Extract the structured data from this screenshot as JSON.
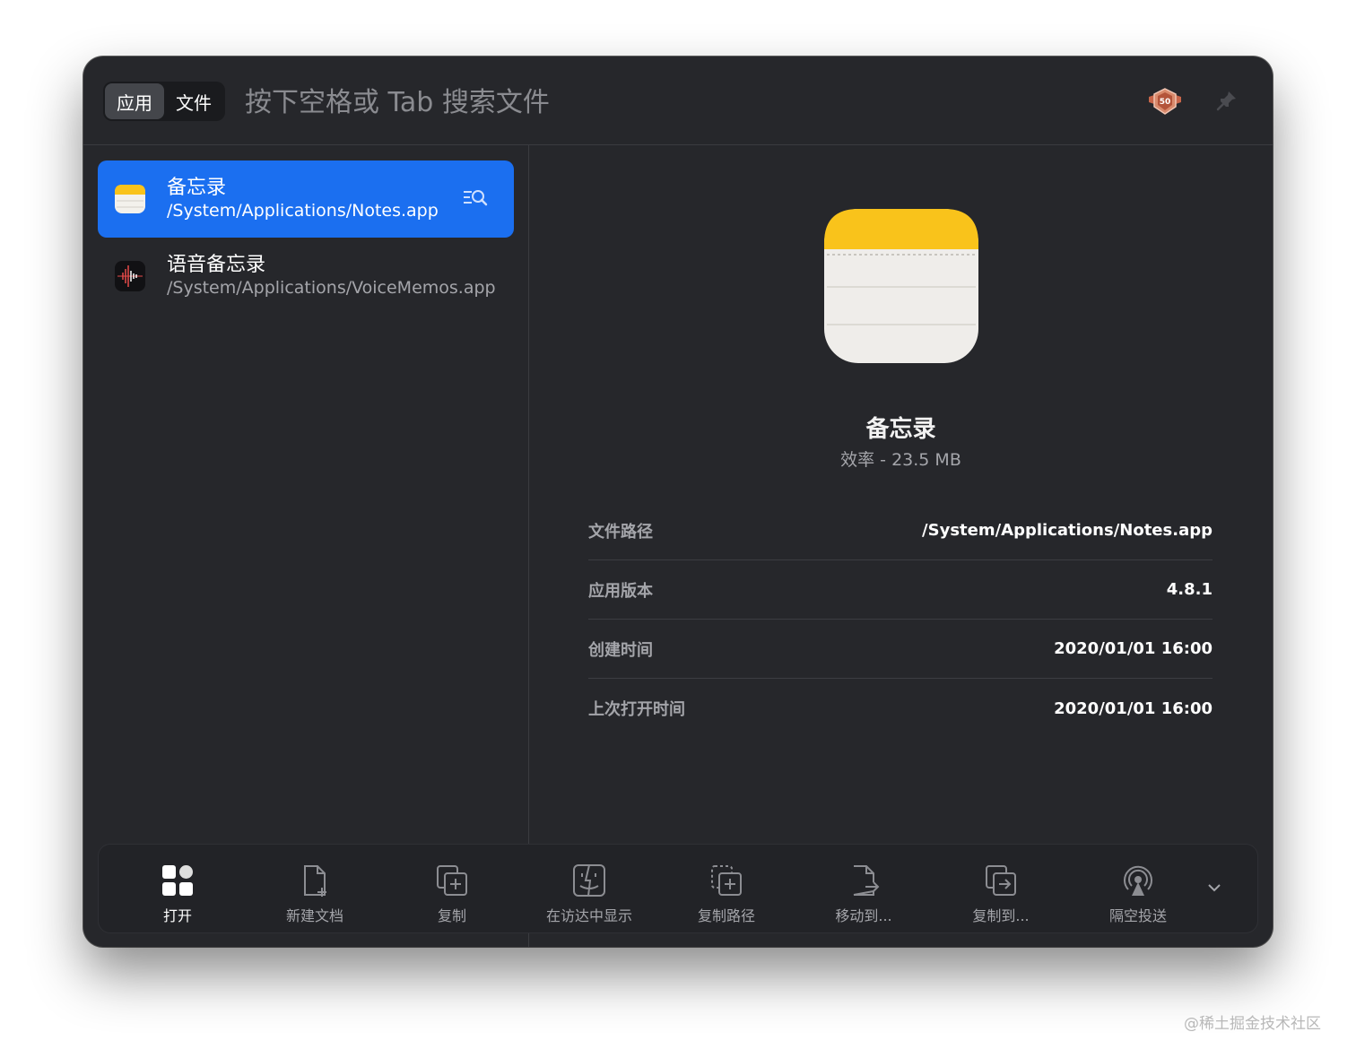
{
  "header": {
    "segments": [
      {
        "label": "应用",
        "active": true
      },
      {
        "label": "文件",
        "active": false
      }
    ],
    "search_placeholder": "按下空格或 Tab 搜索文件",
    "badge_text": "50"
  },
  "results": [
    {
      "title": "备忘录",
      "path": "/System/Applications/Notes.app",
      "selected": true,
      "icon": "notes-app-icon"
    },
    {
      "title": "语音备忘录",
      "path": "/System/Applications/VoiceMemos.app",
      "selected": false,
      "icon": "voice-memos-icon"
    }
  ],
  "detail": {
    "name": "备忘录",
    "subtitle": "效率 - 23.5 MB",
    "fields": [
      {
        "key": "文件路径",
        "value": "/System/Applications/Notes.app"
      },
      {
        "key": "应用版本",
        "value": "4.8.1"
      },
      {
        "key": "创建时间",
        "value": "2020/01/01 16:00"
      },
      {
        "key": "上次打开时间",
        "value": "2020/01/01 16:00"
      }
    ]
  },
  "toolbar": {
    "actions": [
      {
        "label": "打开",
        "icon": "grid-icon"
      },
      {
        "label": "新建文档",
        "icon": "new-document-icon"
      },
      {
        "label": "复制",
        "icon": "duplicate-icon"
      },
      {
        "label": "在访达中显示",
        "icon": "finder-icon"
      },
      {
        "label": "复制路径",
        "icon": "copy-path-icon"
      },
      {
        "label": "移动到...",
        "icon": "move-to-icon"
      },
      {
        "label": "复制到...",
        "icon": "copy-to-icon"
      },
      {
        "label": "隔空投送",
        "icon": "airdrop-icon"
      }
    ]
  },
  "watermark": "@稀土掘金技术社区",
  "colors": {
    "accent": "#1b6ff0",
    "window_bg": "#26272b",
    "notes_yellow": "#f9c31b"
  }
}
